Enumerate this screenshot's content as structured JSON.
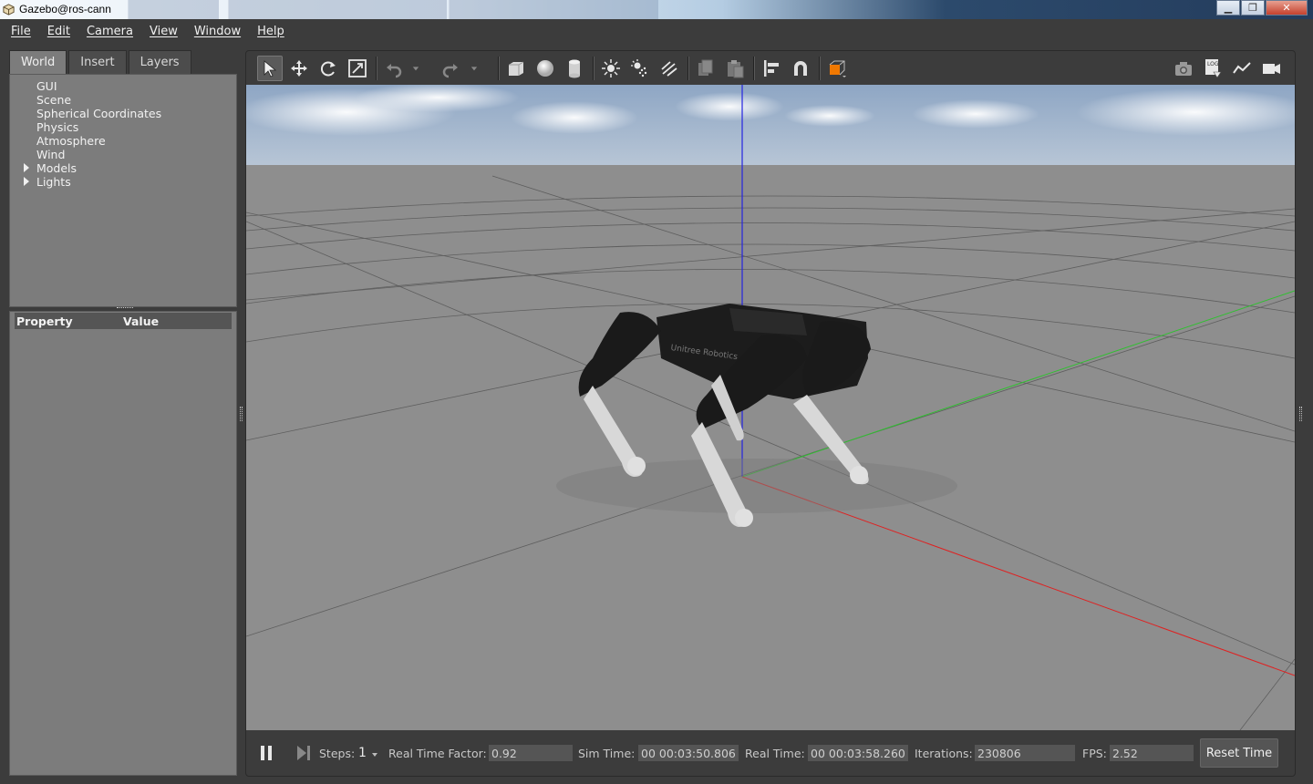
{
  "window": {
    "title": "Gazebo@ros-cann",
    "controls": {
      "minimize": "▁",
      "maximize": "❐",
      "close": "✕"
    }
  },
  "menubar": {
    "items": [
      "File",
      "Edit",
      "Camera",
      "View",
      "Window",
      "Help"
    ]
  },
  "left_panel": {
    "tabs": [
      "World",
      "Insert",
      "Layers"
    ],
    "active_tab": "World",
    "tree": [
      {
        "label": "GUI",
        "expandable": false
      },
      {
        "label": "Scene",
        "expandable": false
      },
      {
        "label": "Spherical Coordinates",
        "expandable": false
      },
      {
        "label": "Physics",
        "expandable": false
      },
      {
        "label": "Atmosphere",
        "expandable": false
      },
      {
        "label": "Wind",
        "expandable": false
      },
      {
        "label": "Models",
        "expandable": true
      },
      {
        "label": "Lights",
        "expandable": true
      }
    ],
    "properties": {
      "col_property": "Property",
      "col_value": "Value"
    }
  },
  "toolbar": {
    "icons": [
      "select-arrow-icon",
      "translate-icon",
      "rotate-icon",
      "scale-icon",
      "undo-icon",
      "undo-dropdown-icon",
      "redo-icon",
      "redo-dropdown-icon",
      "box-icon",
      "sphere-icon",
      "cylinder-icon",
      "point-light-icon",
      "spot-light-icon",
      "directional-light-icon",
      "copy-icon",
      "paste-icon",
      "align-icon",
      "snap-magnet-icon",
      "view-angle-icon",
      "screenshot-icon",
      "log-icon",
      "plot-icon",
      "video-record-icon"
    ]
  },
  "viewport": {
    "robot_label": "Unitree Robotics",
    "axis_colors": {
      "x": "#e02020",
      "y": "#30c030",
      "z": "#2020e0"
    },
    "sky_color": "#9fb3cc",
    "ground_color": "#8c8c8c"
  },
  "bottom_bar": {
    "steps_label": "Steps:",
    "steps_value": "1",
    "rtf_label": "Real Time Factor:",
    "rtf_value": "0.92",
    "sim_time_label": "Sim Time:",
    "sim_time_value": "00 00:03:50.806",
    "real_time_label": "Real Time:",
    "real_time_value": "00 00:03:58.260",
    "iterations_label": "Iterations:",
    "iterations_value": "230806",
    "fps_label": "FPS:",
    "fps_value": "2.52",
    "reset_label": "Reset Time"
  }
}
